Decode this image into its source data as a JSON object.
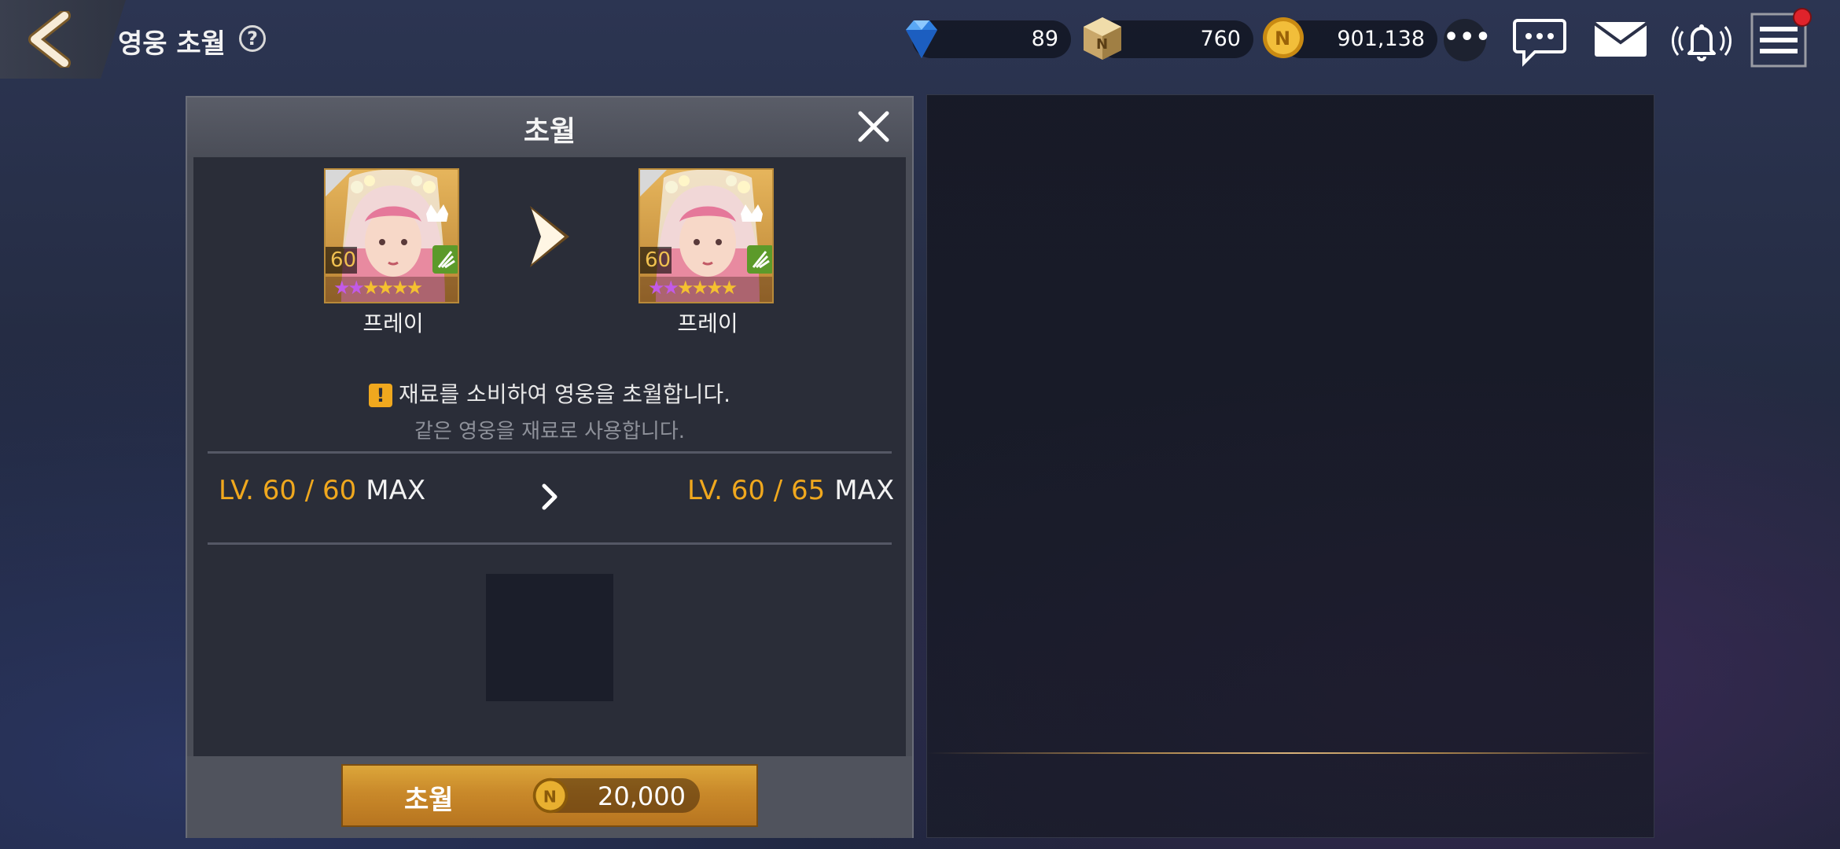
{
  "header": {
    "title": "영웅 초월",
    "help_symbol": "?"
  },
  "currencies": [
    {
      "name": "gem",
      "icon": "diamond-icon",
      "value": "89"
    },
    {
      "name": "material",
      "icon": "cube-icon",
      "value": "760"
    },
    {
      "name": "gold",
      "icon": "gold-coin-icon",
      "value": "901,138"
    }
  ],
  "toolbar": {
    "more_icon": "more-dots-icon",
    "chat_icon": "chat-bubble-icon",
    "mail_icon": "mail-icon",
    "bell_icon": "bell-icon",
    "menu_icon": "hamburger-menu-icon"
  },
  "dialog": {
    "title": "초월",
    "hero_before": {
      "name": "프레이",
      "level": "60",
      "stars_purple": 2,
      "stars_gold": 4
    },
    "hero_after": {
      "name": "프레이",
      "level": "60",
      "stars_purple": 2,
      "stars_gold": 4
    },
    "notice_main": "재료를 소비하여 영웅을 초월합니다.",
    "notice_sub": "같은 영웅을 재료로 사용합니다.",
    "level_before": {
      "lv": "LV. 60 / 60",
      "max": "MAX"
    },
    "level_after": {
      "lv": "LV. 60 / 65",
      "max": "MAX"
    },
    "button_label": "초월",
    "button_cost": "20,000"
  },
  "colors": {
    "accent_gold": "#f0a81e",
    "button_gold": "#c9892a",
    "notification_red": "#e0232b"
  }
}
